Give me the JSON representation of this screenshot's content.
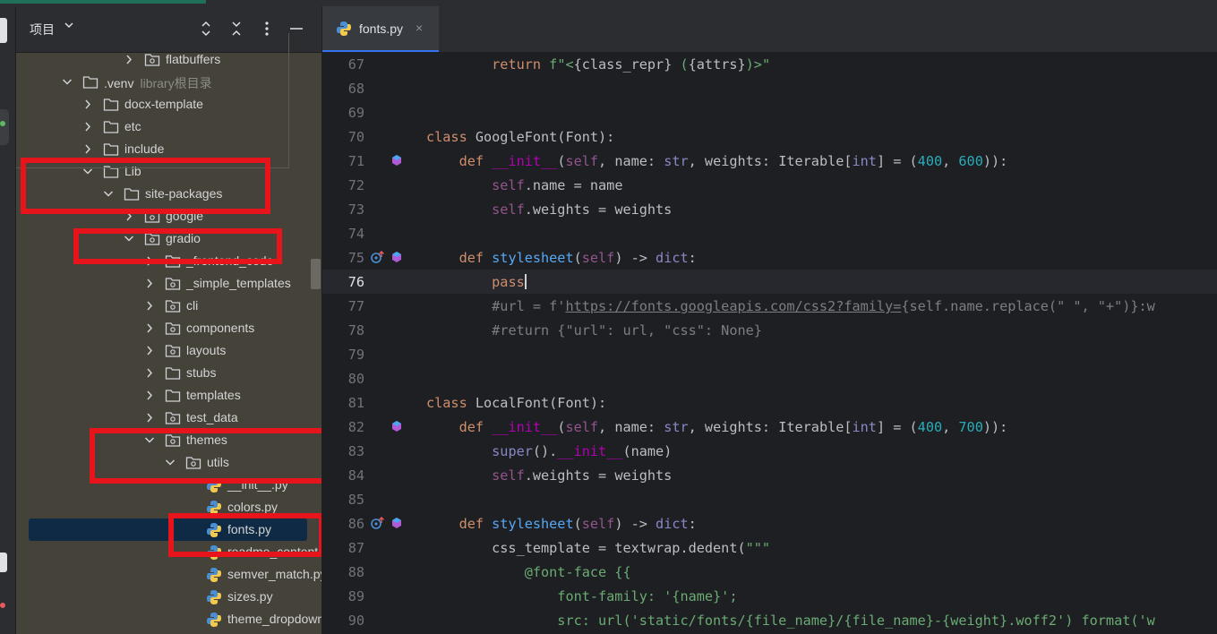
{
  "project_panel": {
    "title": "项目",
    "tree": [
      {
        "label": "flatbuffers",
        "depth": 4,
        "expanded": false,
        "icon": "package-folder-icon"
      },
      {
        "label": ".venv",
        "hint": "library根目录",
        "depth": 1,
        "expanded": true,
        "icon": "folder-icon"
      },
      {
        "label": "docx-template",
        "depth": 2,
        "expanded": false,
        "icon": "folder-icon"
      },
      {
        "label": "etc",
        "depth": 2,
        "expanded": false,
        "icon": "folder-icon"
      },
      {
        "label": "include",
        "depth": 2,
        "expanded": false,
        "icon": "folder-icon"
      },
      {
        "label": "Lib",
        "depth": 2,
        "expanded": true,
        "icon": "folder-icon"
      },
      {
        "label": "site-packages",
        "depth": 3,
        "expanded": true,
        "icon": "folder-icon"
      },
      {
        "label": "google",
        "depth": 4,
        "expanded": false,
        "icon": "package-folder-icon"
      },
      {
        "label": "gradio",
        "depth": 4,
        "expanded": true,
        "icon": "package-folder-icon"
      },
      {
        "label": "_frontend_code",
        "depth": 5,
        "expanded": false,
        "icon": "folder-icon"
      },
      {
        "label": "_simple_templates",
        "depth": 5,
        "expanded": false,
        "icon": "package-folder-icon"
      },
      {
        "label": "cli",
        "depth": 5,
        "expanded": false,
        "icon": "package-folder-icon"
      },
      {
        "label": "components",
        "depth": 5,
        "expanded": false,
        "icon": "package-folder-icon"
      },
      {
        "label": "layouts",
        "depth": 5,
        "expanded": false,
        "icon": "package-folder-icon"
      },
      {
        "label": "stubs",
        "depth": 5,
        "expanded": false,
        "icon": "folder-icon"
      },
      {
        "label": "templates",
        "depth": 5,
        "expanded": false,
        "icon": "folder-icon"
      },
      {
        "label": "test_data",
        "depth": 5,
        "expanded": false,
        "icon": "package-folder-icon"
      },
      {
        "label": "themes",
        "depth": 5,
        "expanded": true,
        "icon": "package-folder-icon"
      },
      {
        "label": "utils",
        "depth": 6,
        "expanded": true,
        "icon": "package-folder-icon"
      },
      {
        "label": "__init__.py",
        "depth": 7,
        "icon": "python-file-icon"
      },
      {
        "label": "colors.py",
        "depth": 7,
        "icon": "python-file-icon"
      },
      {
        "label": "fonts.py",
        "depth": 7,
        "icon": "python-file-icon",
        "selected": true
      },
      {
        "label": "readme_content.py",
        "depth": 7,
        "icon": "python-file-icon"
      },
      {
        "label": "semver_match.py",
        "depth": 7,
        "icon": "python-file-icon"
      },
      {
        "label": "sizes.py",
        "depth": 7,
        "icon": "python-file-icon"
      },
      {
        "label": "theme_dropdown.py",
        "depth": 7,
        "icon": "python-file-icon"
      }
    ]
  },
  "editor": {
    "tab": {
      "label": "fonts.py",
      "close": "×"
    },
    "current_line": 76,
    "lines": [
      {
        "n": "67",
        "tokens": [
          [
            "",
            "        "
          ],
          [
            "kw",
            "return "
          ],
          [
            "str",
            "f\"<"
          ],
          [
            "cls",
            "{class_repr}"
          ],
          [
            "str",
            " ("
          ],
          [
            "cls",
            "{attrs}"
          ],
          [
            "str",
            ")>\""
          ]
        ]
      },
      {
        "n": "68",
        "tokens": []
      },
      {
        "n": "69",
        "tokens": []
      },
      {
        "n": "70",
        "tokens": [
          [
            "kw",
            "class "
          ],
          [
            "cls",
            "GoogleFont(Font):"
          ]
        ]
      },
      {
        "n": "71",
        "gutter": [
          "override-icon"
        ],
        "tokens": [
          [
            "",
            "    "
          ],
          [
            "kw",
            "def "
          ],
          [
            "dunder",
            "__init__"
          ],
          [
            "",
            "("
          ],
          [
            "self",
            "self"
          ],
          [
            "",
            ", name: "
          ],
          [
            "bi",
            "str"
          ],
          [
            "",
            ", weights: Iterable["
          ],
          [
            "bi",
            "int"
          ],
          [
            "",
            "] = ("
          ],
          [
            "num",
            "400"
          ],
          [
            "",
            ", "
          ],
          [
            "num",
            "600"
          ],
          [
            "",
            ")):"
          ]
        ]
      },
      {
        "n": "72",
        "tokens": [
          [
            "",
            "        "
          ],
          [
            "self",
            "self"
          ],
          [
            "",
            ".name = name"
          ]
        ]
      },
      {
        "n": "73",
        "tokens": [
          [
            "",
            "        "
          ],
          [
            "self",
            "self"
          ],
          [
            "",
            ".weights = weights"
          ]
        ]
      },
      {
        "n": "74",
        "tokens": []
      },
      {
        "n": "75",
        "gutter": [
          "overridden-up-icon",
          "override-icon"
        ],
        "tokens": [
          [
            "",
            "    "
          ],
          [
            "kw",
            "def "
          ],
          [
            "fn",
            "stylesheet"
          ],
          [
            "",
            "("
          ],
          [
            "self",
            "self"
          ],
          [
            "",
            ") -> "
          ],
          [
            "bi",
            "dict"
          ],
          [
            "",
            ":"
          ]
        ]
      },
      {
        "n": "76",
        "caret": true,
        "tokens": [
          [
            "",
            "        "
          ],
          [
            "kw",
            "pass"
          ]
        ]
      },
      {
        "n": "77",
        "tokens": [
          [
            "",
            "        "
          ],
          [
            "cmt",
            "#url = f'"
          ],
          [
            "cmt url",
            "https://fonts.googleapis.com/css2?family="
          ],
          [
            "cmt",
            "{self.name.replace(\" \", \"+\")}:w"
          ]
        ]
      },
      {
        "n": "78",
        "tokens": [
          [
            "",
            "        "
          ],
          [
            "cmt",
            "#return {\"url\": url, \"css\": None}"
          ]
        ]
      },
      {
        "n": "79",
        "tokens": []
      },
      {
        "n": "80",
        "tokens": []
      },
      {
        "n": "81",
        "tokens": [
          [
            "kw",
            "class "
          ],
          [
            "cls",
            "LocalFont(Font):"
          ]
        ]
      },
      {
        "n": "82",
        "gutter": [
          "override-icon"
        ],
        "tokens": [
          [
            "",
            "    "
          ],
          [
            "kw",
            "def "
          ],
          [
            "dunder",
            "__init__"
          ],
          [
            "",
            "("
          ],
          [
            "self",
            "self"
          ],
          [
            "",
            ", name: "
          ],
          [
            "bi",
            "str"
          ],
          [
            "",
            ", weights: Iterable["
          ],
          [
            "bi",
            "int"
          ],
          [
            "",
            "] = ("
          ],
          [
            "num",
            "400"
          ],
          [
            "",
            ", "
          ],
          [
            "num",
            "700"
          ],
          [
            "",
            ")):"
          ]
        ]
      },
      {
        "n": "83",
        "tokens": [
          [
            "",
            "        "
          ],
          [
            "bi",
            "super"
          ],
          [
            "",
            "()."
          ],
          [
            "dunder",
            "__init__"
          ],
          [
            "",
            "(name)"
          ]
        ]
      },
      {
        "n": "84",
        "tokens": [
          [
            "",
            "        "
          ],
          [
            "self",
            "self"
          ],
          [
            "",
            ".weights = weights"
          ]
        ]
      },
      {
        "n": "85",
        "tokens": []
      },
      {
        "n": "86",
        "gutter": [
          "overridden-up-icon",
          "override-icon"
        ],
        "tokens": [
          [
            "",
            "    "
          ],
          [
            "kw",
            "def "
          ],
          [
            "fn",
            "stylesheet"
          ],
          [
            "",
            "("
          ],
          [
            "self",
            "self"
          ],
          [
            "",
            ") -> "
          ],
          [
            "bi",
            "dict"
          ],
          [
            "",
            ":"
          ]
        ]
      },
      {
        "n": "87",
        "tokens": [
          [
            "",
            "        css_template = textwrap.dedent("
          ],
          [
            "str",
            "\"\"\""
          ]
        ]
      },
      {
        "n": "88",
        "tokens": [
          [
            "str",
            "            @font-face {{"
          ]
        ]
      },
      {
        "n": "89",
        "tokens": [
          [
            "str",
            "                font-family: '{name}';"
          ]
        ]
      },
      {
        "n": "90",
        "tokens": [
          [
            "str",
            "                src: url('static/fonts/{file_name}/{file_name}-{weight}.woff2') format('w"
          ]
        ]
      }
    ]
  },
  "colors": {
    "highlight_box": "#e8141c",
    "selection": "#0f2a45",
    "tab_accent": "#3574f0"
  }
}
